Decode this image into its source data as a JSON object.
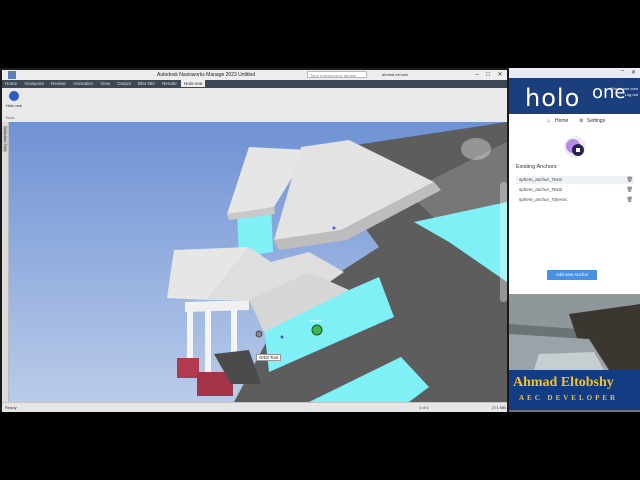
{
  "window": {
    "title": "Autodesk Navisworks Manage 2023    Untitled",
    "search_placeholder": "Type a keyword or phrase",
    "user": "ahmed.elt.holo",
    "minimize": "–",
    "maximize": "□",
    "close": "✕"
  },
  "ribbon_tabs": [
    "Home",
    "Viewpoint",
    "Review",
    "Animation",
    "View",
    "Output",
    "BIM 360",
    "Render",
    "Holo-one"
  ],
  "ribbon": {
    "tool_label": "Holo one",
    "panel_label": "Tools"
  },
  "sidebar": {
    "tab_label": "Selection Tree"
  },
  "viewport": {
    "tooltip": "Orbit Tool",
    "marker_label": "Anchor"
  },
  "status": {
    "ready": "Ready",
    "page": "1 of 1",
    "memory": "271 MB"
  },
  "holo_panel": {
    "logo_left": "holo",
    "logo_right": "one",
    "email": "@holo-one.com",
    "logout": "Log out",
    "nav": {
      "home": "Home",
      "settings": "Settings"
    },
    "anchors_title": "Existing Anchors",
    "anchors": [
      "sphere_anchor_Test1",
      "sphere_anchor_Test2",
      "sphere_anchor_TyleAnc"
    ],
    "add_button": "Add new Anchor"
  },
  "presenter": {
    "name": "Ahmad Eltobshy",
    "title": "AEC DEVELOPER"
  },
  "colors": {
    "sky": "#7ea0d8",
    "roof": "#e6e6e6",
    "wall_cyan": "#7ef0f6",
    "brick": "#b03a50",
    "holo_blue": "#1b3e7d",
    "button_blue": "#4a90e2",
    "name_yellow": "#f2c12e"
  }
}
